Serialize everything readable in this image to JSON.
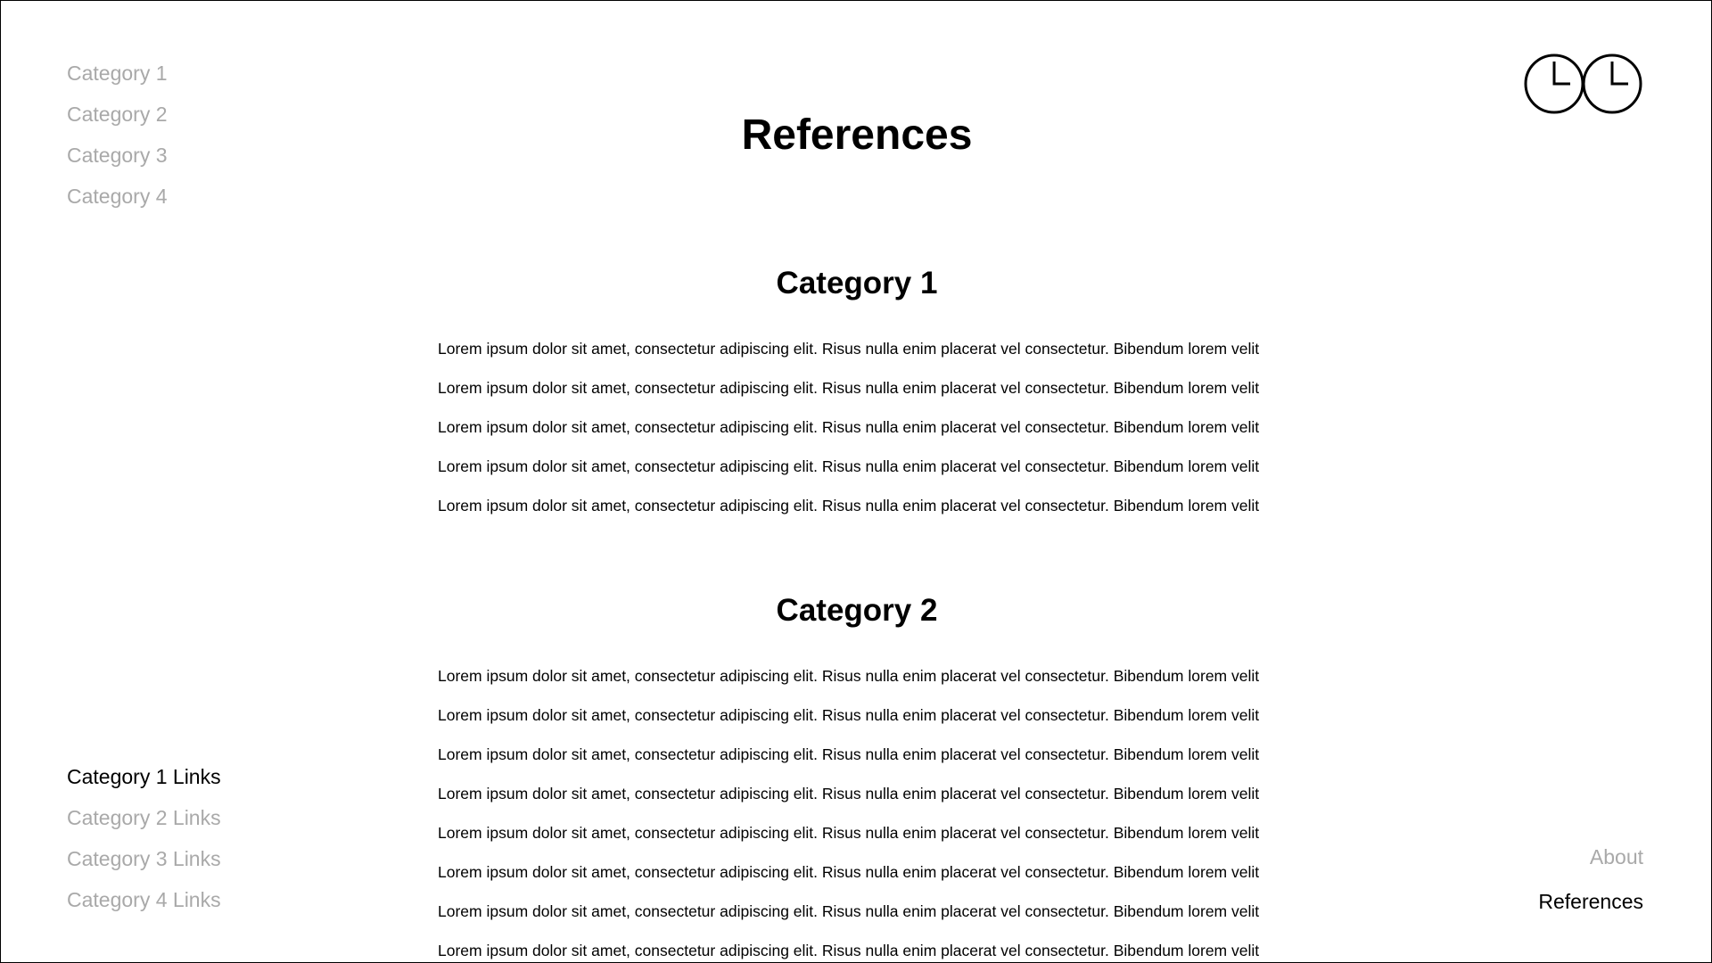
{
  "top_nav": {
    "items": [
      {
        "label": "Category 1"
      },
      {
        "label": "Category 2"
      },
      {
        "label": "Category 3"
      },
      {
        "label": "Category 4"
      }
    ]
  },
  "logo": {
    "icon": "double-clock-icon"
  },
  "page": {
    "title": "References"
  },
  "sections": [
    {
      "heading": "Category 1",
      "references": [
        "Lorem ipsum dolor sit amet, consectetur adipiscing elit. Risus nulla enim placerat vel consectetur. Bibendum lorem velit",
        "Lorem ipsum dolor sit amet, consectetur adipiscing elit. Risus nulla enim placerat vel consectetur. Bibendum lorem velit",
        "Lorem ipsum dolor sit amet, consectetur adipiscing elit. Risus nulla enim placerat vel consectetur. Bibendum lorem velit",
        "Lorem ipsum dolor sit amet, consectetur adipiscing elit. Risus nulla enim placerat vel consectetur. Bibendum lorem velit",
        "Lorem ipsum dolor sit amet, consectetur adipiscing elit. Risus nulla enim placerat vel consectetur. Bibendum lorem velit"
      ]
    },
    {
      "heading": "Category 2",
      "references": [
        "Lorem ipsum dolor sit amet, consectetur adipiscing elit. Risus nulla enim placerat vel consectetur. Bibendum lorem velit",
        "Lorem ipsum dolor sit amet, consectetur adipiscing elit. Risus nulla enim placerat vel consectetur. Bibendum lorem velit",
        "Lorem ipsum dolor sit amet, consectetur adipiscing elit. Risus nulla enim placerat vel consectetur. Bibendum lorem velit",
        "Lorem ipsum dolor sit amet, consectetur adipiscing elit. Risus nulla enim placerat vel consectetur. Bibendum lorem velit",
        "Lorem ipsum dolor sit amet, consectetur adipiscing elit. Risus nulla enim placerat vel consectetur. Bibendum lorem velit",
        "Lorem ipsum dolor sit amet, consectetur adipiscing elit. Risus nulla enim placerat vel consectetur. Bibendum lorem velit",
        "Lorem ipsum dolor sit amet, consectetur adipiscing elit. Risus nulla enim placerat vel consectetur. Bibendum lorem velit",
        "Lorem ipsum dolor sit amet, consectetur adipiscing elit. Risus nulla enim placerat vel consectetur. Bibendum lorem velit"
      ]
    }
  ],
  "links_nav": {
    "items": [
      {
        "label": "Category 1 Links",
        "active": true
      },
      {
        "label": "Category 2 Links",
        "active": false
      },
      {
        "label": "Category 3 Links",
        "active": false
      },
      {
        "label": "Category 4 Links",
        "active": false
      }
    ]
  },
  "page_nav": {
    "items": [
      {
        "label": "About",
        "active": false
      },
      {
        "label": "References",
        "active": true
      }
    ]
  },
  "colors": {
    "text": "#000000",
    "muted": "#a9a9a9",
    "background": "#ffffff"
  }
}
